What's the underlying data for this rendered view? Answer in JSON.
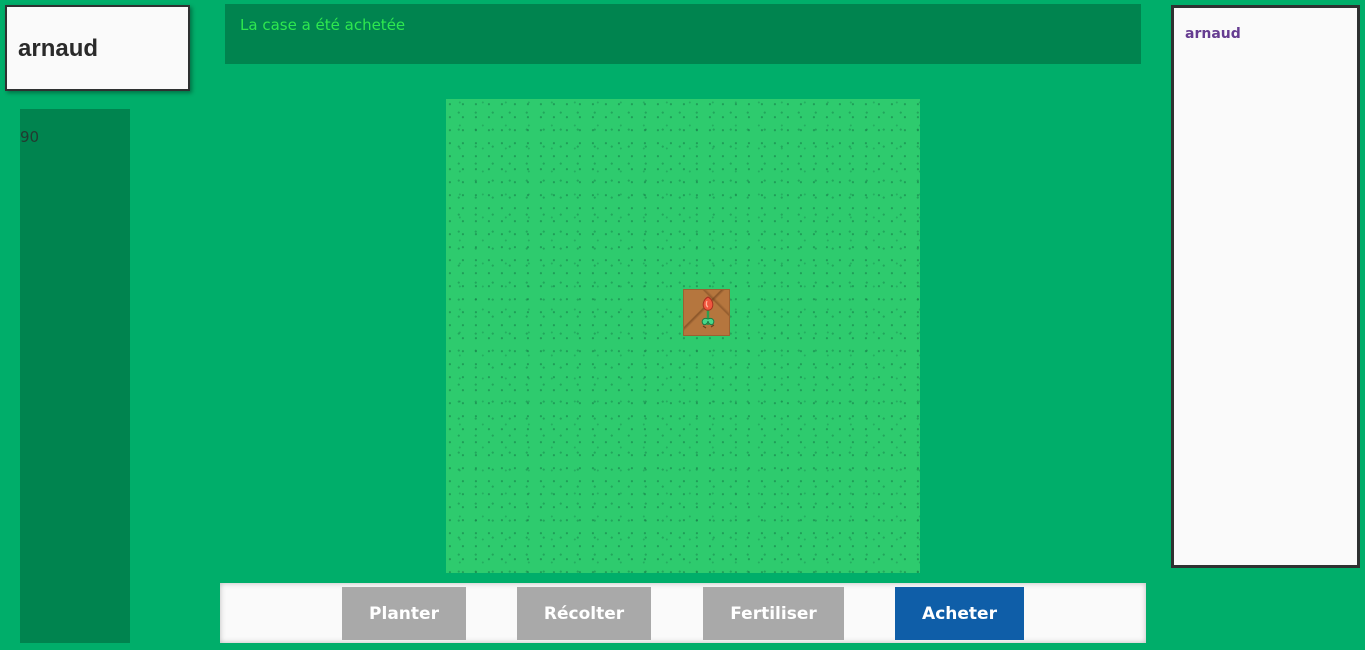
{
  "player": {
    "name": "arnaud",
    "money": "90"
  },
  "message": "La case a été achetée",
  "players_list": [
    "arnaud"
  ],
  "field": {
    "owned_plots": [
      {
        "crop": "flower-sprout",
        "state": "growing"
      }
    ]
  },
  "actions": {
    "plant": "Planter",
    "harvest": "Récolter",
    "fertilize": "Fertiliser",
    "buy": "Acheter"
  },
  "colors": {
    "background": "#00ae6a",
    "panel_dark": "#00844f",
    "grass": "#2ecb6e",
    "soil": "#b5763e",
    "message_text": "#2ee84f",
    "player_list_text": "#663d91",
    "button_inactive": "#a9a9a9",
    "button_active": "#0f5ea8"
  }
}
